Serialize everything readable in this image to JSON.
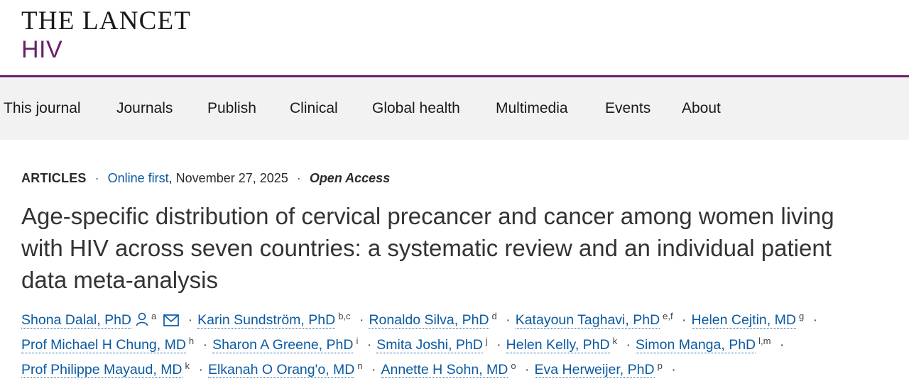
{
  "header": {
    "brand_name": "THE LANCET",
    "brand_sub": "HIV"
  },
  "nav": {
    "items": [
      "This journal",
      "Journals",
      "Publish",
      "Clinical",
      "Global health",
      "Multimedia",
      "Events",
      "About"
    ]
  },
  "article_meta": {
    "type": "ARTICLES",
    "status": "Online first",
    "date": ", November 27, 2025",
    "access": "Open Access"
  },
  "article": {
    "title_lines": [
      "Age-specific distribution of cervical precancer and cancer among women living",
      "with HIV across seven countries: a systematic review and an individual patient",
      "data meta-analysis"
    ]
  },
  "authors": {
    "list": [
      {
        "name": "Shona Dalal, PhD",
        "aff": "a"
      },
      {
        "name": "Karin Sundström, PhD",
        "aff": "b,c"
      },
      {
        "name": "Ronaldo Silva, PhD",
        "aff": "d"
      },
      {
        "name": "Katayoun Taghavi, PhD",
        "aff": "e,f"
      },
      {
        "name": "Helen Cejtin, MD",
        "aff": "g"
      },
      {
        "name": "Prof Michael H Chung, MD",
        "aff": "h"
      },
      {
        "name": "Sharon A Greene, PhD",
        "aff": "i"
      },
      {
        "name": "Smita Joshi, PhD",
        "aff": "j"
      },
      {
        "name": "Helen Kelly, PhD",
        "aff": "k"
      },
      {
        "name": "Simon Manga, PhD",
        "aff": "l,m"
      },
      {
        "name": "Prof Philippe Mayaud, MD",
        "aff": "k"
      },
      {
        "name": "Elkanah O Orang'o, MD",
        "aff": "n"
      },
      {
        "name": "Annette H Sohn, MD",
        "aff": "o"
      },
      {
        "name": "Eva Herweijer, PhD",
        "aff": "p"
      }
    ],
    "separator": "·",
    "icons": [
      "person-icon",
      "envelope-icon"
    ]
  },
  "colors": {
    "brand": "#6b1e6b",
    "link": "#0b5aa2",
    "nav_bg": "#f2f2f2",
    "text": "#2a2a2a"
  }
}
